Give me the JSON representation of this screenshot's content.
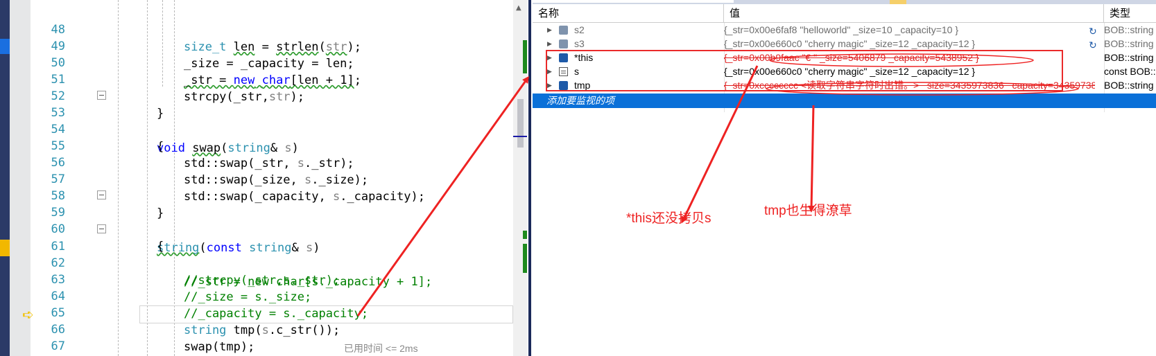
{
  "editor": {
    "lines": [
      {
        "num": "48",
        "code": "size_t len = strlen(str);"
      },
      {
        "num": "49",
        "code": "_size = _capacity = len;"
      },
      {
        "num": "50",
        "code": "_str = new char[len + 1];"
      },
      {
        "num": "51",
        "code": "strcpy(_str,str);"
      },
      {
        "num": "52",
        "code": "}"
      },
      {
        "num": "53",
        "code": "void swap(string& s)"
      },
      {
        "num": "54",
        "code": "{"
      },
      {
        "num": "55",
        "code": "std::swap(_str, s._str);"
      },
      {
        "num": "56",
        "code": "std::swap(_size, s._size);"
      },
      {
        "num": "57",
        "code": "std::swap(_capacity, s._capacity);"
      },
      {
        "num": "58",
        "code": "}"
      },
      {
        "num": "59",
        "code": "string(const string& s)"
      },
      {
        "num": "60",
        "code": "{"
      },
      {
        "num": "61",
        "code": "//_str = new char[s._capacity + 1];"
      },
      {
        "num": "62",
        "code": "//strcpy(_str,s._str);"
      },
      {
        "num": "63",
        "code": "//_size = s._size;"
      },
      {
        "num": "64",
        "code": "//_capacity = s._capacity;"
      },
      {
        "num": "65",
        "code": "string tmp(s.c_str());"
      },
      {
        "num": "66",
        "code": "swap(tmp);"
      },
      {
        "num": "67",
        "code": "}"
      }
    ],
    "timing_hint": "已用时间 <= 2ms"
  },
  "watch": {
    "headers": {
      "name": "名称",
      "value": "值",
      "type": "类型"
    },
    "rows": [
      {
        "name": "s2",
        "value": "{_str=0x00e6faf8 \"helloworld\" _size=10 _capacity=10 }",
        "type": "BOB::string"
      },
      {
        "name": "s3",
        "value": "{_str=0x00e660c0 \"cherry magic\" _size=12 _capacity=12 }",
        "type": "BOB::string"
      },
      {
        "name": "*this",
        "value": "{_str=0x00b9faac \"€    \" _size=5406879 _capacity=5438952 }",
        "type": "BOB::string"
      },
      {
        "name": "s",
        "value": "{_str=0x00e660c0 \"cherry magic\" _size=12 _capacity=12 }",
        "type": "const BOB::string"
      },
      {
        "name": "tmp",
        "value": "{_str=0xcccccccc <读取字符串字符时出错。> _size=3435973836 _capacity=3435973836 }",
        "type": "BOB::string"
      }
    ],
    "add_item": "添加要监视的项"
  },
  "annotations": {
    "this_note": "*this还没拷贝s",
    "tmp_note": "tmp也生得潦草",
    "color": "#ee2222"
  }
}
